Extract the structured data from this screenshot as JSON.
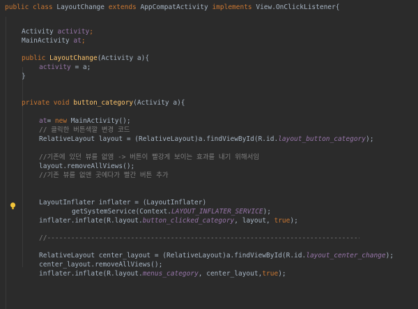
{
  "code": {
    "l1": {
      "a": "public class ",
      "b": "LayoutChange ",
      "c": "extends ",
      "d": "AppCompatActivity ",
      "e": "implements ",
      "f": "View.OnClickListener{"
    },
    "l2": {
      "a": "Activity ",
      "b": "activity",
      "c": ";"
    },
    "l3": {
      "a": "MainActivity ",
      "b": "at",
      "c": ";"
    },
    "l4": {
      "a": "public ",
      "b": "LayoutChange",
      "c": "(Activity a){"
    },
    "l5": {
      "a": "activity ",
      "b": "= a;"
    },
    "l6": {
      "a": "}"
    },
    "l7": {
      "a": "private void ",
      "b": "button_category",
      "c": "(Activity a){"
    },
    "l8": {
      "a": "at",
      "b": "= ",
      "c": "new ",
      "d": "MainActivity();"
    },
    "l9": {
      "a": "// 클릭한 버튼색깔 변경 코드"
    },
    "l10": {
      "a": "RelativeLayout layout = (RelativeLayout)a.findViewById(R.id.",
      "b": "layout_button_category",
      "c": ");"
    },
    "l11": {
      "a": "//기존에 있던 뷰를 없앰 -> 버튼이 빨강게 보이는 효과를 내기 위해서임"
    },
    "l12": {
      "a": "layout.removeAllViews();"
    },
    "l13": {
      "a": "//기존 뷰를 없앤 곳에다가 빨간 버튼 추가"
    },
    "l14": {
      "a": "LayoutInflater inflater = (LayoutInflater)"
    },
    "l15": {
      "a": "getSystemService(Context.",
      "b": "LAYOUT_INFLATER_SERVICE",
      "c": ");"
    },
    "l16": {
      "a": "inflater.inflate(R.layout.",
      "b": "button_clicked_category",
      "c": ", layout, ",
      "d": "true",
      "e": ");"
    },
    "l17": {
      "a": "//--------------------------------------------------------------------------------"
    },
    "l18": {
      "a": "RelativeLayout center_layout = (RelativeLayout)a.findViewById(R.id.",
      "b": "layout_center_change",
      "c": ");"
    },
    "l19": {
      "a": "center_layout.removeAllViews();"
    },
    "l20": {
      "a": "inflater.inflate(R.layout.",
      "b": "menus_category",
      "c": ", center_layout,",
      "d": "true",
      "e": ");"
    }
  }
}
